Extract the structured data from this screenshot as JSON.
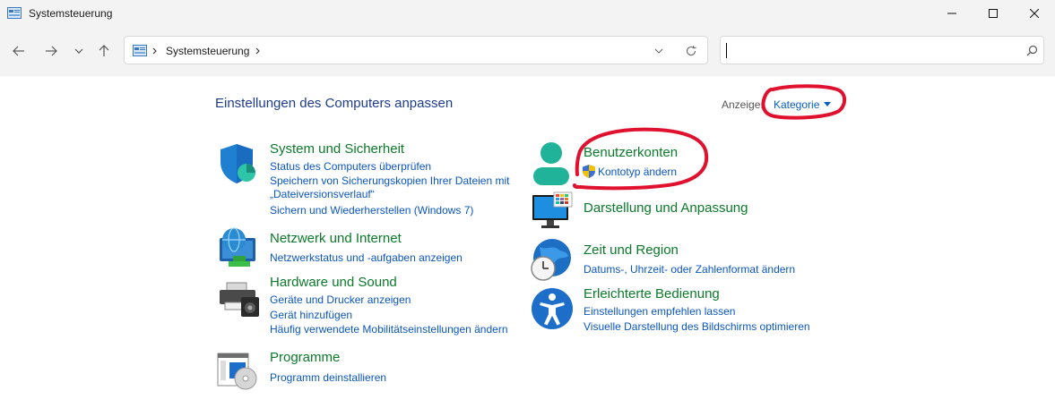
{
  "window": {
    "title": "Systemsteuerung",
    "controls": [
      "minimize",
      "maximize",
      "close"
    ]
  },
  "navigation": {
    "breadcrumb": [
      "Systemsteuerung"
    ],
    "search": {
      "placeholder": "",
      "value": ""
    }
  },
  "main": {
    "heading": "Einstellungen des Computers anpassen",
    "view": {
      "label": "Anzeige:",
      "selected": "Kategorie"
    }
  },
  "categories": {
    "system": {
      "title": "System und Sicherheit",
      "icon": "shield-icon",
      "links": [
        "Status des Computers überprüfen",
        "Speichern von Sicherungskopien Ihrer Dateien mit",
        "„Dateiversionsverlauf“",
        "Sichern und Wiederherstellen (Windows 7)"
      ]
    },
    "network": {
      "title": "Netzwerk und Internet",
      "icon": "network-globe-icon",
      "links": [
        "Netzwerkstatus und -aufgaben anzeigen"
      ]
    },
    "hardware": {
      "title": "Hardware und Sound",
      "icon": "printer-speaker-icon",
      "links": [
        "Geräte und Drucker anzeigen",
        "Gerät hinzufügen",
        "Häufig verwendete Mobilitätseinstellungen ändern"
      ]
    },
    "programs": {
      "title": "Programme",
      "icon": "programs-disc-icon",
      "links": [
        "Programm deinstallieren"
      ]
    },
    "users": {
      "title": "Benutzerkonten",
      "icon": "user-icon",
      "links": [
        "Kontotyp ändern"
      ]
    },
    "appearance": {
      "title": "Darstellung und Anpassung",
      "icon": "monitor-icon",
      "links": []
    },
    "region": {
      "title": "Zeit und Region",
      "icon": "clock-globe-icon",
      "links": [
        "Datums-, Uhrzeit- oder Zahlenformat ändern"
      ]
    },
    "access": {
      "title": "Erleichterte Bedienung",
      "icon": "accessibility-icon",
      "links": [
        "Einstellungen empfehlen lassen",
        "Visuelle Darstellung des Bildschirms optimieren"
      ]
    }
  },
  "annotations": {
    "color": "#e0102f"
  }
}
